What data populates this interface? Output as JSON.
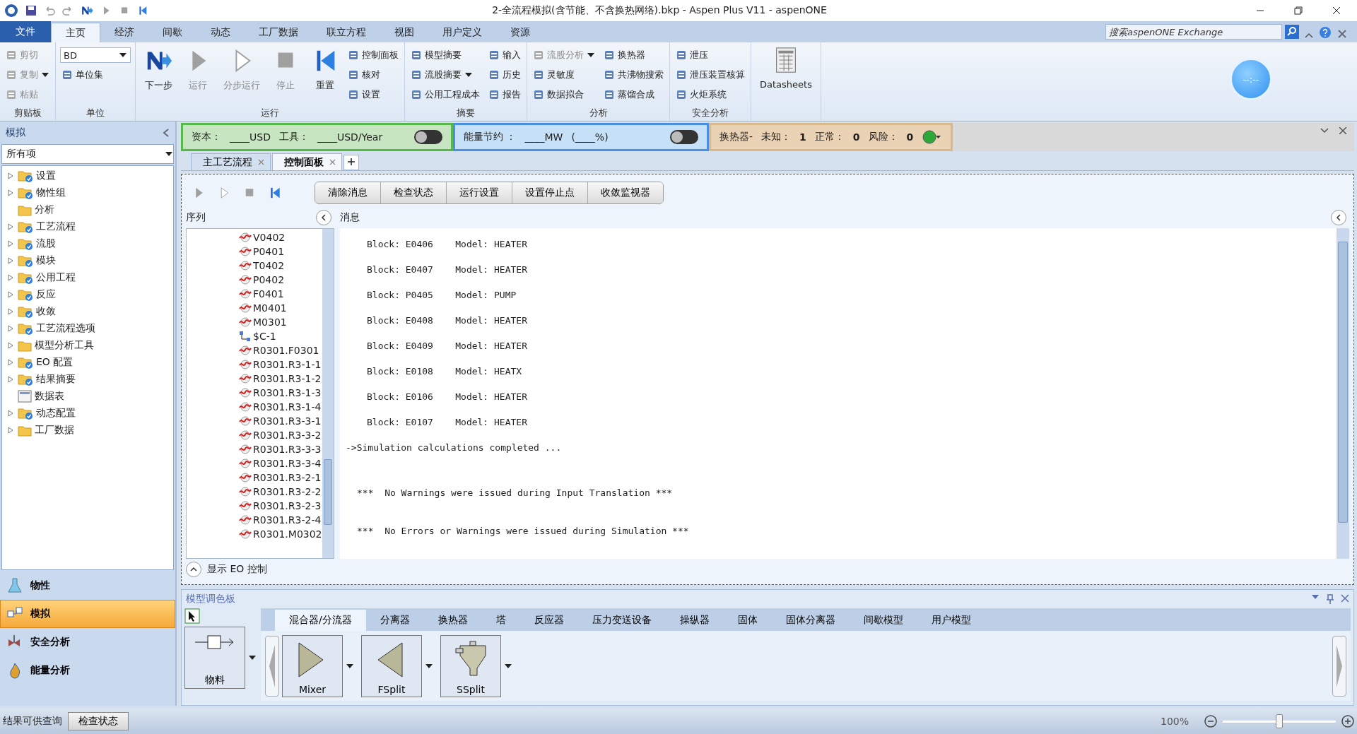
{
  "window": {
    "title": "2-全流程模拟(含节能、不含换热网络).bkp - Aspen Plus V11 - aspenONE"
  },
  "ribbon_tabs": [
    {
      "label": "文件",
      "kind": "file",
      "selected": false
    },
    {
      "label": "主页",
      "kind": "tab",
      "selected": true
    },
    {
      "label": "经济",
      "kind": "tab",
      "selected": false
    },
    {
      "label": "间歇",
      "kind": "tab",
      "selected": false
    },
    {
      "label": "动态",
      "kind": "tab",
      "selected": false
    },
    {
      "label": "工厂数据",
      "kind": "tab",
      "selected": false
    },
    {
      "label": "联立方程",
      "kind": "tab",
      "selected": false
    },
    {
      "label": "视图",
      "kind": "tab",
      "selected": false
    },
    {
      "label": "用户定义",
      "kind": "tab",
      "selected": false
    },
    {
      "label": "资源",
      "kind": "tab",
      "selected": false
    }
  ],
  "search": {
    "placeholder": "搜索aspenONE Exchange"
  },
  "ribbon_groups": [
    {
      "label": "剪贴板",
      "small": [
        {
          "label": "剪切",
          "disabled": true
        },
        {
          "label": "复制",
          "disabled": true,
          "has_menu": true
        },
        {
          "label": "粘贴",
          "disabled": true
        }
      ]
    },
    {
      "label": "单位",
      "dropdown": "BD",
      "small": [
        {
          "label": "单位集",
          "disabled": false
        }
      ]
    },
    {
      "label": "运行",
      "large": [
        {
          "label": "下一步",
          "kind": "next",
          "disabled": false
        },
        {
          "label": "运行",
          "kind": "play",
          "disabled": true
        },
        {
          "label": "分步运行",
          "kind": "step",
          "disabled": true
        },
        {
          "label": "停止",
          "kind": "stop",
          "disabled": true
        },
        {
          "label": "重置",
          "kind": "reset",
          "disabled": false
        }
      ],
      "small": [
        {
          "label": "控制面板",
          "disabled": false
        },
        {
          "label": "核对",
          "disabled": false
        },
        {
          "label": "设置",
          "disabled": false
        }
      ]
    },
    {
      "label": "摘要",
      "small": [
        {
          "label": "模型摘要",
          "disabled": false
        },
        {
          "label": "流股摘要",
          "disabled": false,
          "has_menu": true
        },
        {
          "label": "公用工程成本",
          "disabled": false
        },
        {
          "label": "输入",
          "disabled": false
        },
        {
          "label": "历史",
          "disabled": false
        },
        {
          "label": "报告",
          "disabled": false
        }
      ]
    },
    {
      "label": "分析",
      "small": [
        {
          "label": "流股分析",
          "disabled": true,
          "has_menu": true
        },
        {
          "label": "灵敏度",
          "disabled": false
        },
        {
          "label": "数据拟合",
          "disabled": false
        },
        {
          "label": "换热器",
          "disabled": false
        },
        {
          "label": "共沸物搜索",
          "disabled": false
        },
        {
          "label": "蒸馏合成",
          "disabled": false
        }
      ]
    },
    {
      "label": "安全分析",
      "small": [
        {
          "label": "泄压",
          "disabled": false
        },
        {
          "label": "泄压装置核算",
          "disabled": false
        },
        {
          "label": "火炬系统",
          "disabled": false
        }
      ]
    },
    {
      "large": [
        {
          "label": "Datasheets",
          "kind": "datasheet",
          "disabled": false
        }
      ]
    }
  ],
  "clock_badge": "--:--",
  "sidebar": {
    "title": "模拟",
    "filter": "所有项",
    "items": [
      {
        "label": "设置",
        "expandable": true,
        "kind": "checked-folder"
      },
      {
        "label": "物性组",
        "expandable": true,
        "kind": "checked-folder"
      },
      {
        "label": "分析",
        "expandable": false,
        "kind": "folder"
      },
      {
        "label": "工艺流程",
        "expandable": true,
        "kind": "checked-folder"
      },
      {
        "label": "流股",
        "expandable": true,
        "kind": "checked-folder"
      },
      {
        "label": "模块",
        "expandable": true,
        "kind": "checked-folder"
      },
      {
        "label": "公用工程",
        "expandable": true,
        "kind": "checked-folder"
      },
      {
        "label": "反应",
        "expandable": true,
        "kind": "checked-folder"
      },
      {
        "label": "收敛",
        "expandable": true,
        "kind": "checked-folder"
      },
      {
        "label": "工艺流程选项",
        "expandable": true,
        "kind": "checked-folder"
      },
      {
        "label": "模型分析工具",
        "expandable": true,
        "kind": "folder"
      },
      {
        "label": "EO 配置",
        "expandable": true,
        "kind": "checked-folder"
      },
      {
        "label": "结果摘要",
        "expandable": true,
        "kind": "checked-folder"
      },
      {
        "label": "数据表",
        "expandable": false,
        "kind": "sheet"
      },
      {
        "label": "动态配置",
        "expandable": true,
        "kind": "checked-folder"
      },
      {
        "label": "工厂数据",
        "expandable": true,
        "kind": "folder"
      }
    ],
    "nav": [
      {
        "label": "物性",
        "kind": "flask",
        "selected": false
      },
      {
        "label": "模拟",
        "kind": "flowsheet",
        "selected": true
      },
      {
        "label": "安全分析",
        "kind": "safety",
        "selected": false
      },
      {
        "label": "能量分析",
        "kind": "energy",
        "selected": false
      }
    ]
  },
  "info_bars": {
    "capital": {
      "items": [
        {
          "label": "资本：",
          "value": "____USD"
        },
        {
          "label": "工具：",
          "value": "____USD/Year"
        }
      ],
      "on": false
    },
    "energy": {
      "label": "能量节约 ：",
      "value": "____MW",
      "percent": "(____%)",
      "on": false
    },
    "exchangers": {
      "label": "换热器-",
      "counts": [
        {
          "label": "未知：",
          "value": "1"
        },
        {
          "label": "正常：",
          "value": "0"
        },
        {
          "label": "风险：",
          "value": "0"
        }
      ]
    }
  },
  "doc_tabs": [
    {
      "label": "主工艺流程",
      "selected": false
    },
    {
      "label": "控制面板",
      "selected": true
    }
  ],
  "control_panel": {
    "toolbar": [
      {
        "kind": "play",
        "disabled": true
      },
      {
        "kind": "step",
        "disabled": true
      },
      {
        "kind": "stop",
        "disabled": true
      },
      {
        "kind": "reset",
        "disabled": false
      }
    ],
    "buttons": [
      "清除消息",
      "检查状态",
      "运行设置",
      "设置停止点",
      "收敛监视器"
    ],
    "sequence_header": "序列",
    "messages_header": "消息",
    "sequence": [
      {
        "name": "V0402",
        "kind": "block"
      },
      {
        "name": "P0401",
        "kind": "block"
      },
      {
        "name": "T0402",
        "kind": "block"
      },
      {
        "name": "P0402",
        "kind": "block"
      },
      {
        "name": "F0401",
        "kind": "block"
      },
      {
        "name": "M0401",
        "kind": "block"
      },
      {
        "name": "M0301",
        "kind": "block"
      },
      {
        "name": "$C-1",
        "kind": "convergence"
      },
      {
        "name": "R0301.F0301",
        "kind": "block"
      },
      {
        "name": "R0301.R3-1-1",
        "kind": "block"
      },
      {
        "name": "R0301.R3-1-2",
        "kind": "block"
      },
      {
        "name": "R0301.R3-1-3",
        "kind": "block"
      },
      {
        "name": "R0301.R3-1-4",
        "kind": "block"
      },
      {
        "name": "R0301.R3-3-1",
        "kind": "block"
      },
      {
        "name": "R0301.R3-3-2",
        "kind": "block"
      },
      {
        "name": "R0301.R3-3-3",
        "kind": "block"
      },
      {
        "name": "R0301.R3-3-4",
        "kind": "block"
      },
      {
        "name": "R0301.R3-2-1",
        "kind": "block"
      },
      {
        "name": "R0301.R3-2-2",
        "kind": "block"
      },
      {
        "name": "R0301.R3-2-3",
        "kind": "block"
      },
      {
        "name": "R0301.R3-2-4",
        "kind": "block"
      },
      {
        "name": "R0301.M0302",
        "kind": "block"
      }
    ],
    "messages": [
      {
        "kind": "block",
        "text": "Block: E0406    Model: HEATER"
      },
      {
        "kind": "block",
        "text": "Block: E0407    Model: HEATER"
      },
      {
        "kind": "block",
        "text": "Block: P0405    Model: PUMP"
      },
      {
        "kind": "block",
        "text": "Block: E0408    Model: HEATER"
      },
      {
        "kind": "block",
        "text": "Block: E0409    Model: HEATER"
      },
      {
        "kind": "block",
        "text": "Block: E0108    Model: HEATX"
      },
      {
        "kind": "block",
        "text": "Block: E0106    Model: HEATER"
      },
      {
        "kind": "block",
        "text": "Block: E0107    Model: HEATER"
      },
      {
        "kind": "status",
        "text": "->Simulation calculations completed ..."
      },
      {
        "kind": "notice",
        "text": "***  No Warnings were issued during Input Translation ***"
      },
      {
        "kind": "notice",
        "text": "***  No Errors or Warnings were issued during Simulation ***"
      }
    ],
    "eo_toggle": "显示 EO 控制"
  },
  "palette": {
    "title": "模型调色板",
    "tabs": [
      {
        "label": "混合器/分流器",
        "selected": true
      },
      {
        "label": "分离器",
        "selected": false
      },
      {
        "label": "换热器",
        "selected": false
      },
      {
        "label": "塔",
        "selected": false
      },
      {
        "label": "反应器",
        "selected": false
      },
      {
        "label": "压力变送设备",
        "selected": false
      },
      {
        "label": "操纵器",
        "selected": false
      },
      {
        "label": "固体",
        "selected": false
      },
      {
        "label": "固体分离器",
        "selected": false
      },
      {
        "label": "间歇模型",
        "selected": false
      },
      {
        "label": "用户模型",
        "selected": false
      }
    ],
    "stream": {
      "label": "物料"
    },
    "models": [
      {
        "label": "Mixer",
        "kind": "mixer"
      },
      {
        "label": "FSplit",
        "kind": "fsplit"
      },
      {
        "label": "SSplit",
        "kind": "ssplit"
      }
    ]
  },
  "status_bar": {
    "message": "结果可供查询",
    "button": "检查状态",
    "zoom": "100%",
    "zoom_slider": {
      "level": 0.5
    }
  }
}
